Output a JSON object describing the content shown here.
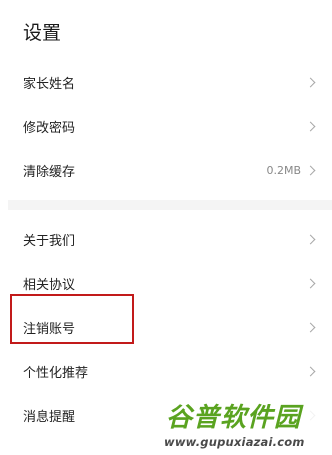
{
  "header": {
    "title": "设置"
  },
  "groups": [
    {
      "items": [
        {
          "label": "家长姓名",
          "value": ""
        },
        {
          "label": "修改密码",
          "value": ""
        },
        {
          "label": "清除缓存",
          "value": "0.2MB"
        }
      ]
    },
    {
      "items": [
        {
          "label": "关于我们",
          "value": ""
        },
        {
          "label": "相关协议",
          "value": ""
        },
        {
          "label": "注销账号",
          "value": ""
        },
        {
          "label": "个性化推荐",
          "value": ""
        },
        {
          "label": "消息提醒",
          "value": ""
        }
      ]
    }
  ],
  "highlight": {
    "target": "注销账号",
    "color": "#c21a1a"
  },
  "watermark": {
    "title": "谷普软件园",
    "url": "www.gupuxiazai.com",
    "color": "#5aa320"
  }
}
